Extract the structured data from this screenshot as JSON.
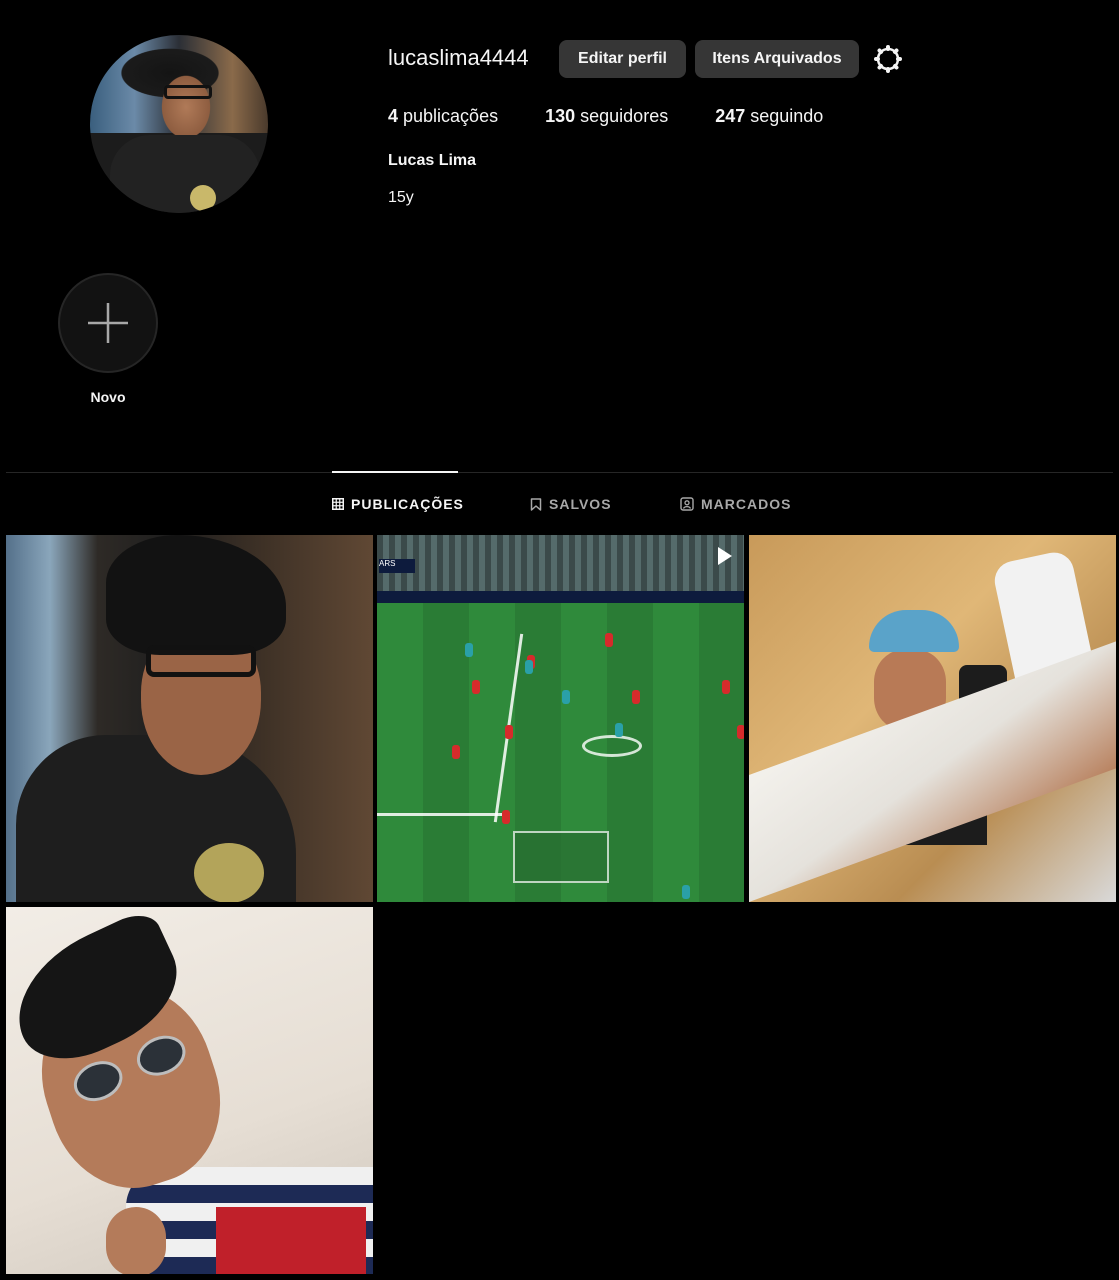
{
  "profile": {
    "username": "lucaslima4444",
    "edit_label": "Editar perfil",
    "archive_label": "Itens Arquivados",
    "full_name": "Lucas Lima",
    "bio": "15y",
    "stats": {
      "posts_count": "4",
      "posts_label": " publicações",
      "followers_count": "130",
      "followers_label": " seguidores",
      "following_count": "247",
      "following_label": " seguindo"
    }
  },
  "highlights": {
    "new_label": "Novo"
  },
  "tabs": [
    {
      "label": "PUBLICAÇÕES",
      "active": true,
      "icon": "grid-icon"
    },
    {
      "label": "SALVOS",
      "active": false,
      "icon": "bookmark-icon"
    },
    {
      "label": "MARCADOS",
      "active": false,
      "icon": "tag-user-icon"
    }
  ],
  "posts": [
    {
      "type": "photo"
    },
    {
      "type": "video",
      "overlay_text": "ARS"
    },
    {
      "type": "photo"
    },
    {
      "type": "photo"
    }
  ],
  "colors": {
    "background": "#000000",
    "button": "#363636",
    "muted_text": "#a8a8a8",
    "divider": "#262626"
  }
}
